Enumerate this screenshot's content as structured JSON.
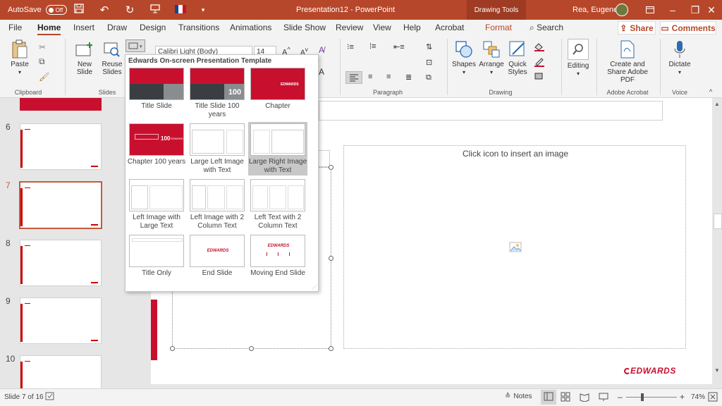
{
  "titlebar": {
    "autosave_label": "AutoSave",
    "autosave_state": "Off",
    "title": "Presentation12  -  PowerPoint",
    "drawing_tools": "Drawing Tools",
    "user_name": "Rea, Eugene"
  },
  "menu": {
    "tabs": [
      "File",
      "Home",
      "Insert",
      "Draw",
      "Design",
      "Transitions",
      "Animations",
      "Slide Show",
      "Review",
      "View",
      "Help",
      "Acrobat",
      "Format"
    ],
    "search": "Search",
    "share": "Share",
    "comments": "Comments"
  },
  "ribbon": {
    "paste": "Paste",
    "new_slide": "New Slide",
    "reuse_slides": "Reuse Slides",
    "font_name": "Calibri Light (Body)",
    "font_size": "14",
    "shapes": "Shapes",
    "arrange": "Arrange",
    "quick_styles": "Quick Styles",
    "editing": "Editing",
    "create_share": "Create and Share Adobe PDF",
    "dictate": "Dictate",
    "groups": {
      "clipboard": "Clipboard",
      "slides": "Slides",
      "paragraph": "Paragraph",
      "drawing": "Drawing",
      "adobe": "Adobe Acrobat",
      "voice": "Voice"
    }
  },
  "layout_dropdown": {
    "header": "Edwards On-screen Presentation Template",
    "items": [
      {
        "label": "Title Slide"
      },
      {
        "label": "Title Slide 100 years"
      },
      {
        "label": "Chapter"
      },
      {
        "label": "Chapter 100 years"
      },
      {
        "label": "Large Left Image with Text"
      },
      {
        "label": "Large Right Image with Text"
      },
      {
        "label": "Left Image with Large Text"
      },
      {
        "label": "Left Image with 2 Column Text"
      },
      {
        "label": "Left Text with 2 Column Text"
      },
      {
        "label": "Title Only"
      },
      {
        "label": "End Slide"
      },
      {
        "label": "Moving End Slide"
      }
    ],
    "brand": "EDWARDS",
    "hundred": "100"
  },
  "slides": {
    "numbers": [
      "6",
      "7",
      "8",
      "9",
      "10"
    ],
    "selected": "7"
  },
  "canvas": {
    "image_placeholder": "Click icon to insert an image",
    "logo": "EDWARDS"
  },
  "status": {
    "slide_info": "Slide 7 of 16",
    "notes": "Notes",
    "zoom": "74%"
  },
  "colors": {
    "brand_red": "#c8102e",
    "title_bar": "#b7472a"
  }
}
